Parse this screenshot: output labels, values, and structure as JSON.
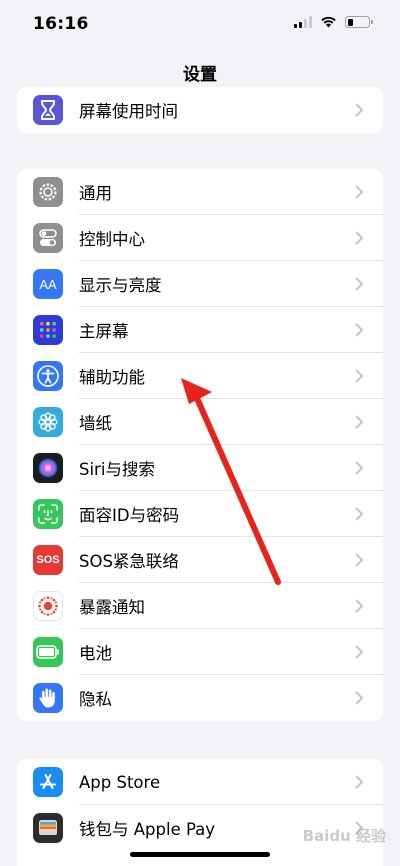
{
  "status_bar": {
    "time": "16:16"
  },
  "nav": {
    "title": "设置"
  },
  "group_screen_time": {
    "items": [
      {
        "label": "屏幕使用时间",
        "icon": "hourglass-icon",
        "color": "#5856d6"
      }
    ]
  },
  "group_general": {
    "items": [
      {
        "label": "通用",
        "icon": "gear-icon",
        "color": "#8e8e93"
      },
      {
        "label": "控制中心",
        "icon": "toggles-icon",
        "color": "#8e8e93"
      },
      {
        "label": "显示与亮度",
        "icon": "aa-icon",
        "color": "#3478f6"
      },
      {
        "label": "主屏幕",
        "icon": "home-grid-icon",
        "color": "#2c3bd6"
      },
      {
        "label": "辅助功能",
        "icon": "accessibility-icon",
        "color": "#3478f6"
      },
      {
        "label": "墙纸",
        "icon": "flower-icon",
        "color": "#35aadc"
      },
      {
        "label": "Siri与搜索",
        "icon": "siri-icon",
        "color": "#1c1c1e"
      },
      {
        "label": "面容ID与密码",
        "icon": "faceid-icon",
        "color": "#34c759"
      },
      {
        "label": "SOS紧急联络",
        "icon": "sos-icon",
        "color": "#e53935"
      },
      {
        "label": "暴露通知",
        "icon": "exposure-icon",
        "color": "#ffffff"
      },
      {
        "label": "电池",
        "icon": "battery-icon",
        "color": "#34c759"
      },
      {
        "label": "隐私",
        "icon": "hand-icon",
        "color": "#3478f6"
      }
    ]
  },
  "group_store": {
    "items": [
      {
        "label": "App Store",
        "icon": "appstore-icon",
        "color": "#1a8cf5"
      },
      {
        "label": "钱包与 Apple Pay",
        "icon": "wallet-icon",
        "color": "#2c2c2e"
      }
    ]
  },
  "sos_icon_text": "SOS",
  "aa_icon_text": "AA",
  "watermark": "Baidu 经验",
  "annotation_color": "#e8231c"
}
